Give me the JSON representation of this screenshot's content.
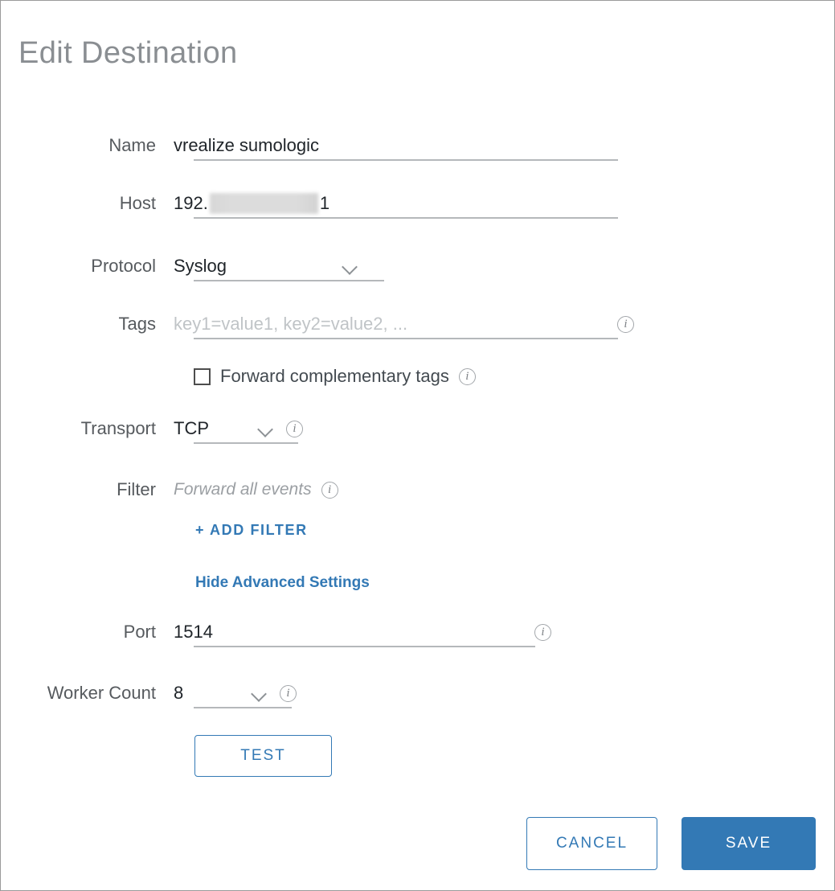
{
  "dialog": {
    "title": "Edit Destination"
  },
  "fields": {
    "name": {
      "label": "Name",
      "value": "vrealize sumologic"
    },
    "host": {
      "label": "Host",
      "value_prefix": "192.",
      "value_suffix": "1",
      "redacted": true
    },
    "protocol": {
      "label": "Protocol",
      "value": "Syslog",
      "icon": "chevron-down-icon"
    },
    "tags": {
      "label": "Tags",
      "placeholder": "key1=value1, key2=value2, ...",
      "value": "",
      "info_icon": "info-icon"
    },
    "forward_complementary_tags": {
      "label": "Forward complementary tags",
      "checked": false,
      "info_icon": "info-icon"
    },
    "transport": {
      "label": "Transport",
      "value": "TCP",
      "icon": "chevron-down-icon",
      "info_icon": "info-icon"
    },
    "filter": {
      "label": "Filter",
      "value": "Forward all events",
      "info_icon": "info-icon"
    },
    "port": {
      "label": "Port",
      "value": "1514",
      "info_icon": "info-icon"
    },
    "worker_count": {
      "label": "Worker Count",
      "value": "8",
      "icon": "chevron-down-icon",
      "info_icon": "info-icon"
    }
  },
  "links": {
    "add_filter": "+ ADD FILTER",
    "advanced_settings": "Hide Advanced Settings"
  },
  "buttons": {
    "test": "TEST",
    "cancel": "CANCEL",
    "save": "SAVE"
  },
  "info_glyph": "i",
  "colors": {
    "accent": "#3379b5",
    "title": "#8a8e92",
    "label": "#565a5e",
    "value": "#20252a",
    "placeholder": "#c0c4c7",
    "underline": "#b5b8bb",
    "border": "#9a9a9a"
  }
}
